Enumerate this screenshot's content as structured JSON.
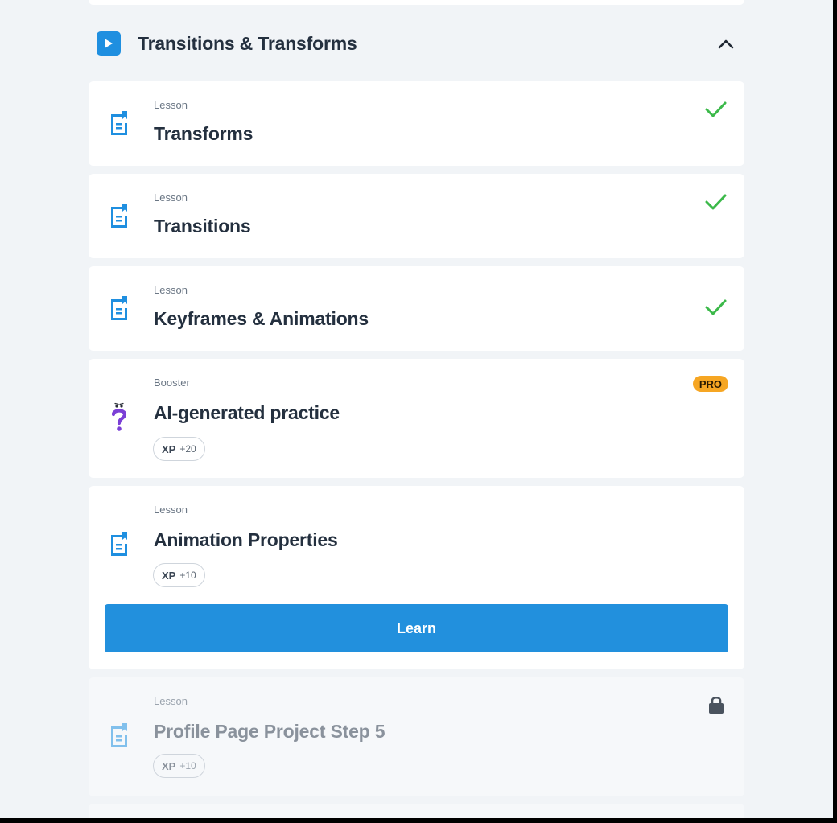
{
  "section": {
    "title": "Transitions & Transforms",
    "icon": "play-icon",
    "toggle_icon": "chevron-up-icon",
    "accent": "#1f8fe0"
  },
  "items": [
    {
      "kind": "Lesson",
      "title": "Transforms",
      "status": "completed",
      "icon": "lesson-doc-icon"
    },
    {
      "kind": "Lesson",
      "title": "Transitions",
      "status": "completed",
      "icon": "lesson-doc-icon"
    },
    {
      "kind": "Lesson",
      "title": "Keyframes & Animations",
      "status": "completed",
      "icon": "lesson-doc-icon"
    },
    {
      "kind": "Booster",
      "title": "AI-generated practice",
      "badge": "PRO",
      "xp_label": "XP",
      "xp_value": "+20",
      "icon": "ai-question-icon"
    },
    {
      "kind": "Lesson",
      "title": "Animation Properties",
      "xp_label": "XP",
      "xp_value": "+10",
      "button_label": "Learn",
      "status": "current",
      "icon": "lesson-doc-icon"
    },
    {
      "kind": "Lesson",
      "title": "Profile Page Project Step 5",
      "xp_label": "XP",
      "xp_value": "+10",
      "status": "locked",
      "icon": "lesson-doc-icon"
    }
  ],
  "colors": {
    "check": "#3cb94a",
    "pro_badge": "#f6a623",
    "learn_button": "#2290dd",
    "lesson_icon": "#1f8fe0",
    "booster_icon": "#7b3fd6"
  }
}
